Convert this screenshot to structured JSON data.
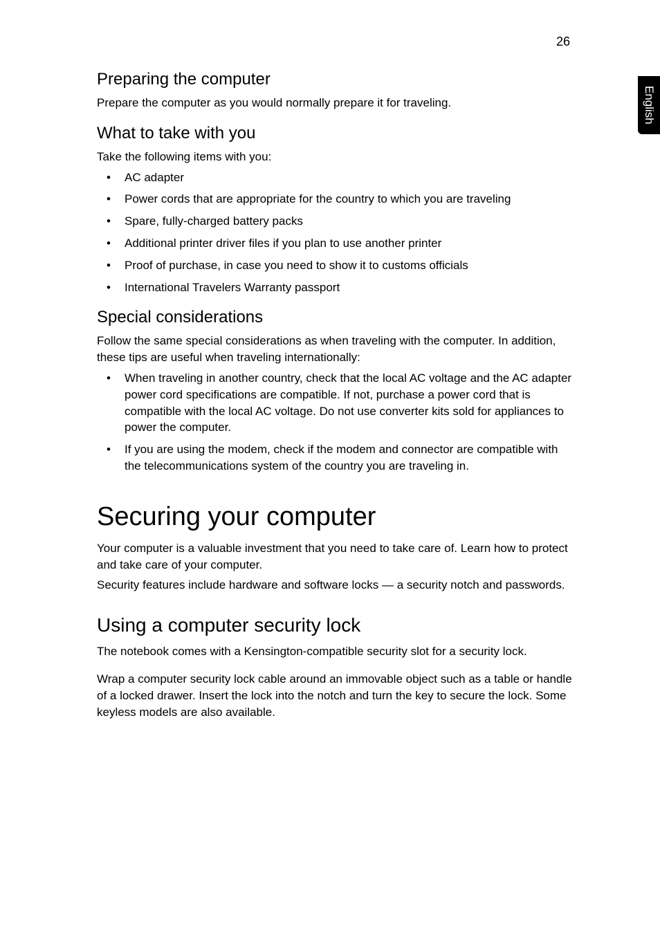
{
  "pageNumber": "26",
  "sideTab": "English",
  "sections": {
    "preparing": {
      "heading": "Preparing the computer",
      "body": "Prepare the computer as you would normally prepare it for traveling."
    },
    "whatToTake": {
      "heading": "What to take with you",
      "intro": "Take the following items with you:",
      "items": [
        "AC adapter",
        "Power cords that are appropriate for the country to which you are traveling",
        "Spare, fully-charged battery packs",
        "Additional printer driver files if you plan to use another printer",
        "Proof of purchase, in case you need to show it to customs officials",
        "International Travelers Warranty passport"
      ]
    },
    "special": {
      "heading": "Special considerations",
      "intro": "Follow the same special considerations as when traveling with the computer. In addition, these tips are useful when traveling internationally:",
      "items": [
        "When traveling in another country, check that the local AC voltage and the AC adapter power cord specifications are compatible. If not, purchase a power cord that is compatible with the local AC voltage. Do not use converter kits sold for appliances to power the computer.",
        "If you are using the modem, check if the modem and connector are compatible with the telecommunications system of the country you are traveling in."
      ]
    },
    "securing": {
      "heading": "Securing your computer",
      "p1": "Your computer is a valuable investment that you need to take care of. Learn how to protect and take care of your computer.",
      "p2": "Security features include hardware and software locks — a security notch and passwords."
    },
    "securityLock": {
      "heading": "Using a computer security lock",
      "p1": "The notebook comes with a Kensington-compatible security slot for a security lock.",
      "p2": "Wrap a computer security lock cable around an immovable object such as a table or handle of a locked drawer. Insert the lock into the notch and turn the key to secure the lock. Some keyless models are also available."
    }
  }
}
